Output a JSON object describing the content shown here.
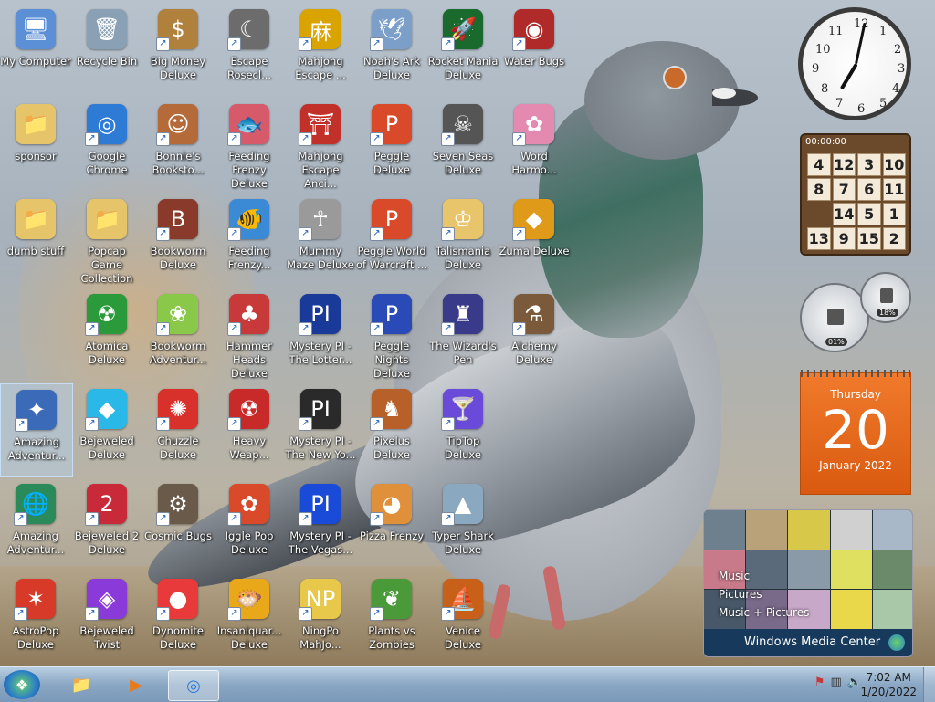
{
  "desktop": {
    "icons": [
      {
        "label": "My Computer",
        "icon": "computer-icon",
        "color": "#5b8fd6",
        "glyph": "🖥"
      },
      {
        "label": "Recycle Bin",
        "icon": "recycle-bin-icon",
        "color": "#8aa0b4",
        "glyph": "🗑"
      },
      {
        "label": "Big Money Deluxe",
        "icon": "money-bag-icon",
        "color": "#b0813c",
        "glyph": "$"
      },
      {
        "label": "Escape Rosecl...",
        "icon": "moon-icon",
        "color": "#6c6c6c",
        "glyph": "☾"
      },
      {
        "label": "Mahjong Escape ...",
        "icon": "mahjong-tile-icon",
        "color": "#d9a400",
        "glyph": "麻"
      },
      {
        "label": "Noah's Ark Deluxe",
        "icon": "dove-icon",
        "color": "#7b9fc8",
        "glyph": "🕊"
      },
      {
        "label": "Rocket Mania Deluxe",
        "icon": "rocket-icon",
        "color": "#1a6a2e",
        "glyph": "🚀"
      },
      {
        "label": "Water Bugs",
        "icon": "porthole-icon",
        "color": "#b02a2a",
        "glyph": "◉"
      },
      {
        "label": "sponsor",
        "icon": "folder-icon",
        "color": "#e6c56a",
        "glyph": "📁"
      },
      {
        "label": "Google Chrome",
        "icon": "chrome-icon",
        "color": "#2e7bd6",
        "glyph": "◎"
      },
      {
        "label": "Bonnie's Booksto...",
        "icon": "girl-icon",
        "color": "#b56a3a",
        "glyph": "☺"
      },
      {
        "label": "Feeding Frenzy Deluxe",
        "icon": "fish-icon",
        "color": "#d65a6a",
        "glyph": "🐟"
      },
      {
        "label": "Mahjong Escape Anci...",
        "icon": "torii-gate-icon",
        "color": "#c2302a",
        "glyph": "⛩"
      },
      {
        "label": "Peggle Deluxe",
        "icon": "peggle-icon",
        "color": "#d84a2a",
        "glyph": "P"
      },
      {
        "label": "Seven Seas Deluxe",
        "icon": "skull-icon",
        "color": "#555555",
        "glyph": "☠"
      },
      {
        "label": "Word Harmo...",
        "icon": "flower-icon",
        "color": "#e48ab0",
        "glyph": "✿"
      },
      {
        "label": "dumb stuff",
        "icon": "folder-icon",
        "color": "#e6c56a",
        "glyph": "📁"
      },
      {
        "label": "Popcap Game Collection",
        "icon": "folder-icon",
        "color": "#e6c56a",
        "glyph": "📁"
      },
      {
        "label": "Bookworm Deluxe",
        "icon": "book-icon",
        "color": "#8a3a2a",
        "glyph": "B"
      },
      {
        "label": "Feeding Frenzy...",
        "icon": "fish-icon",
        "color": "#3a8ad6",
        "glyph": "🐠"
      },
      {
        "label": "Mummy Maze Deluxe",
        "icon": "mummy-icon",
        "color": "#9a9a9a",
        "glyph": "☥"
      },
      {
        "label": "Peggle World of Warcraft ...",
        "icon": "peggle-icon",
        "color": "#d84a2a",
        "glyph": "P"
      },
      {
        "label": "Talismania Deluxe",
        "icon": "king-icon",
        "color": "#e8c46a",
        "glyph": "♔"
      },
      {
        "label": "Zuma Deluxe",
        "icon": "zuma-idol-icon",
        "color": "#e09a1a",
        "glyph": "◆"
      },
      {
        "label": "Atomica Deluxe",
        "icon": "atom-icon",
        "color": "#2a9a3a",
        "glyph": "☢"
      },
      {
        "label": "Bookworm Adventur...",
        "icon": "worm-icon",
        "color": "#8ac84a",
        "glyph": "❀"
      },
      {
        "label": "Hammer Heads Deluxe",
        "icon": "gnome-icon",
        "color": "#c83a3a",
        "glyph": "♣"
      },
      {
        "label": "Mystery PI - The Lotter...",
        "icon": "mystery-pi-icon",
        "color": "#1a3a9a",
        "glyph": "PI"
      },
      {
        "label": "Peggle Nights Deluxe",
        "icon": "peggle-icon",
        "color": "#2a4ab8",
        "glyph": "P"
      },
      {
        "label": "The Wizard's Pen",
        "icon": "wizard-tower-icon",
        "color": "#3a3a8a",
        "glyph": "♜"
      },
      {
        "label": "Alchemy Deluxe",
        "icon": "alchemist-icon",
        "color": "#7a5a3a",
        "glyph": "⚗"
      },
      {
        "label": "Amazing Adventur...",
        "icon": "compass-icon",
        "color": "#3a6ab8",
        "glyph": "✦"
      },
      {
        "label": "Bejeweled Deluxe",
        "icon": "gem-icon",
        "color": "#2ab8e8",
        "glyph": "◆"
      },
      {
        "label": "Chuzzle Deluxe",
        "icon": "chuzzle-icon",
        "color": "#d8302a",
        "glyph": "✺"
      },
      {
        "label": "Heavy Weap...",
        "icon": "radiation-icon",
        "color": "#c82a2a",
        "glyph": "☢"
      },
      {
        "label": "Mystery PI - The New Yo...",
        "icon": "mystery-pi-icon",
        "color": "#2a2a2a",
        "glyph": "PI"
      },
      {
        "label": "Pixelus Deluxe",
        "icon": "explorer-icon",
        "color": "#b8602a",
        "glyph": "♞"
      },
      {
        "label": "TipTop Deluxe",
        "icon": "cocktail-icon",
        "color": "#6a4ad8",
        "glyph": "🍸"
      },
      {
        "label": "Amazing Adventur...",
        "icon": "globe-icon",
        "color": "#2a8a5a",
        "glyph": "🌐"
      },
      {
        "label": "Bejeweled 2 Deluxe",
        "icon": "gem-two-icon",
        "color": "#c82a3a",
        "glyph": "2"
      },
      {
        "label": "Cosmic Bugs",
        "icon": "gear-icon",
        "color": "#6a5a4a",
        "glyph": "⚙"
      },
      {
        "label": "Iggle Pop Deluxe",
        "icon": "iggle-icon",
        "color": "#d84a2a",
        "glyph": "✿"
      },
      {
        "label": "Mystery PI - The Vegas...",
        "icon": "mystery-pi-icon",
        "color": "#1a4ad8",
        "glyph": "PI"
      },
      {
        "label": "Pizza Frenzy",
        "icon": "pizza-icon",
        "color": "#e0903a",
        "glyph": "◕"
      },
      {
        "label": "Typer Shark Deluxe",
        "icon": "shark-icon",
        "color": "#8aa8c0",
        "glyph": "▲"
      },
      {
        "label": "AstroPop Deluxe",
        "icon": "astropop-icon",
        "color": "#d83a2a",
        "glyph": "✶"
      },
      {
        "label": "Bejeweled Twist",
        "icon": "twist-gem-icon",
        "color": "#8a3ad8",
        "glyph": "◈"
      },
      {
        "label": "Dynomite Deluxe",
        "icon": "egg-icon",
        "color": "#e83a3a",
        "glyph": "●"
      },
      {
        "label": "Insaniquar... Deluxe",
        "icon": "fish-icon",
        "color": "#e8a81a",
        "glyph": "🐡"
      },
      {
        "label": "NingPo MahJo...",
        "icon": "ningpo-tile-icon",
        "color": "#e8c84a",
        "glyph": "NP"
      },
      {
        "label": "Plants vs Zombies",
        "icon": "plant-icon",
        "color": "#4a9a3a",
        "glyph": "❦"
      },
      {
        "label": "Venice Deluxe",
        "icon": "gondola-icon",
        "color": "#c8601a",
        "glyph": "⛵"
      }
    ]
  },
  "gadgets": {
    "clock": {
      "hour": 7,
      "minute": 2
    },
    "puzzle": {
      "timer": "00:00:00",
      "tiles": [
        "4",
        "12",
        "3",
        "10",
        "8",
        "7",
        "6",
        "11",
        "",
        "14",
        "5",
        "1",
        "13",
        "9",
        "15",
        "2"
      ]
    },
    "cpu_meter": {
      "cpu": "01%",
      "memory": "18%"
    },
    "calendar": {
      "day_name": "Thursday",
      "day": "20",
      "month_year": "January 2022"
    },
    "media_center": {
      "links": [
        "Music",
        "Pictures",
        "Music + Pictures"
      ],
      "title": "Windows Media Center"
    }
  },
  "taskbar": {
    "start": "start-orb",
    "pinned": [
      {
        "name": "explorer",
        "glyph": "📁"
      },
      {
        "name": "media-player",
        "glyph": "▶"
      },
      {
        "name": "chrome",
        "glyph": "◎"
      }
    ],
    "time": "7:02 AM",
    "date": "1/20/2022"
  }
}
